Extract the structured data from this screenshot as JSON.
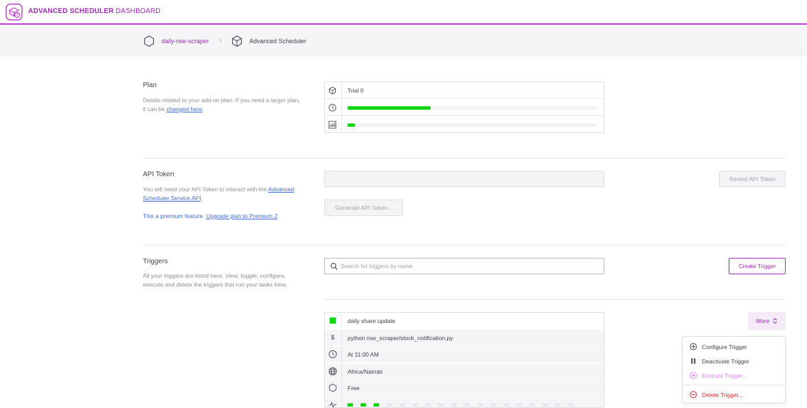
{
  "header": {
    "brand": "ADVANCED SCHEDULER",
    "title_rest": "DASHBOARD",
    "logo_icon": "scheduler-logo-icon"
  },
  "breadcrumb": {
    "app_name": "daily-nse-scraper",
    "separator": "›",
    "addon_name": "Advanced Scheduler"
  },
  "plan": {
    "title": "Plan",
    "desc_prefix": "Details related to your add-on plan. If you need a larger plan, it can be ",
    "desc_link": "changed here",
    "desc_suffix": ".",
    "plan_name": "Trial 0",
    "usage_fraction": 0.333,
    "second_usage_fraction": 0.03
  },
  "api_token": {
    "title": "API Token",
    "desc_prefix": "You will need your API Token to interact with the ",
    "desc_link": "Advanced Scheduler Service API",
    "desc_suffix": ".",
    "premium_prefix": "This a premium feature. ",
    "premium_link": "Upgrade plan to Premium 2",
    "reveal_label": "Reveal API Token",
    "generate_label": "Generate API Token..."
  },
  "triggers": {
    "title": "Triggers",
    "desc": "All your triggers are listed here. View, toggle, configure, execute and delete the triggers that run your tasks here.",
    "search_placeholder": "Search for triggers by name",
    "create_label": "Create Trigger",
    "items": [
      {
        "name": "daily share update",
        "status": "active",
        "command_symbol": "$",
        "command": "python nse_scraper/stock_notification.py",
        "schedule": "At 11:00 AM",
        "timezone": "Africa/Nairobi",
        "dyno_size": "Free",
        "history": [
          "success",
          "success",
          "success",
          "none",
          "none",
          "none",
          "none",
          "none",
          "none",
          "none",
          "none",
          "none",
          "none",
          "none",
          "none",
          "none",
          "none",
          "none"
        ]
      }
    ],
    "more_label": "More",
    "menu": [
      {
        "label": "Configure Trigger",
        "icon": "plus-circle-icon",
        "state": "normal"
      },
      {
        "label": "Deactivate Trigger",
        "icon": "pause-icon",
        "state": "normal"
      },
      {
        "label": "Execute Trigger...",
        "icon": "execute-icon",
        "state": "disabled"
      },
      {
        "label": "Delete Trigger...",
        "icon": "minus-circle-icon",
        "state": "danger"
      }
    ]
  },
  "colors": {
    "accent": "#9b2bb3",
    "success": "#11d611",
    "danger": "#d62a2a",
    "link": "#3f6bd8"
  }
}
